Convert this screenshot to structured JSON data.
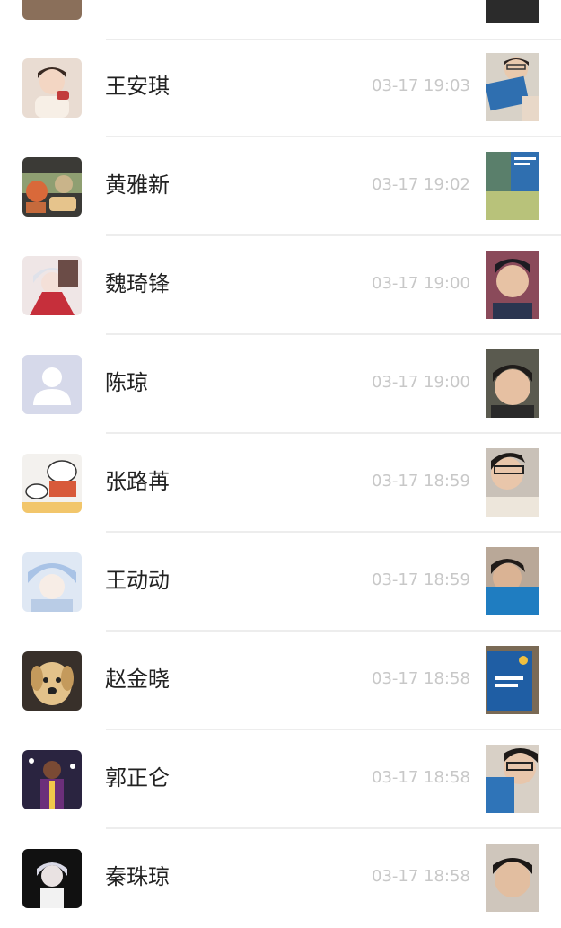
{
  "contacts": [
    {
      "name": "王安琪",
      "time": "03-17 19:03"
    },
    {
      "name": "黄雅新",
      "time": "03-17 19:02"
    },
    {
      "name": "魏琦锋",
      "time": "03-17 19:00"
    },
    {
      "name": "陈琼",
      "time": "03-17 19:00"
    },
    {
      "name": "张路苒",
      "time": "03-17 18:59"
    },
    {
      "name": "王动动",
      "time": "03-17 18:59"
    },
    {
      "name": "赵金晓",
      "time": "03-17 18:58"
    },
    {
      "name": "郭正仑",
      "time": "03-17 18:58"
    },
    {
      "name": "秦珠琼",
      "time": "03-17 18:58"
    }
  ]
}
